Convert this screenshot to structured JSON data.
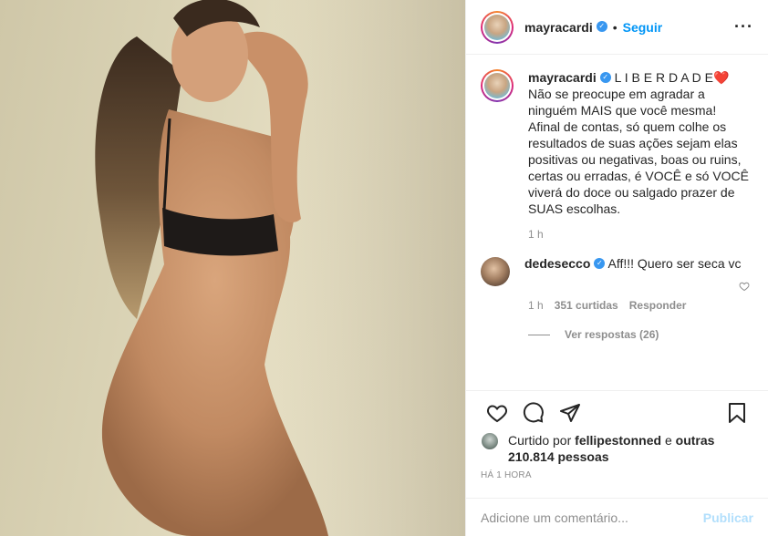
{
  "header": {
    "username": "mayracardi",
    "separator": "•",
    "follow_label": "Seguir",
    "more_icon": "more-horizontal-icon"
  },
  "caption": {
    "username": "mayracardi",
    "title": "L I B E R D A D E❤️",
    "body": "Não se preocupe em agradar a ninguém MAIS que você mesma! Afinal de contas, só quem colhe os resultados de suas ações sejam elas positivas ou negativas, boas ou ruins, certas ou erradas, é VOCÊ e só VOCÊ viverá do doce ou salgado prazer de SUAS escolhas.",
    "time": "1 h"
  },
  "comment": {
    "username": "dedesecco",
    "text": "Aff!!! Quero ser seca vc",
    "time": "1 h",
    "likes": "351 curtidas",
    "reply_label": "Responder",
    "view_replies": "Ver respostas (26)"
  },
  "likes": {
    "prefix": "Curtido por",
    "user": "fellipestonned",
    "and": "e",
    "others": "outras 210.814 pessoas"
  },
  "timestamp": "HÁ 1 HORA",
  "add_comment": {
    "placeholder": "Adicione um comentário...",
    "publish_label": "Publicar"
  },
  "colors": {
    "accent": "#0095f6",
    "verified": "#3897f0",
    "muted": "#8e8e8e",
    "publish_disabled": "#b2dffc"
  }
}
